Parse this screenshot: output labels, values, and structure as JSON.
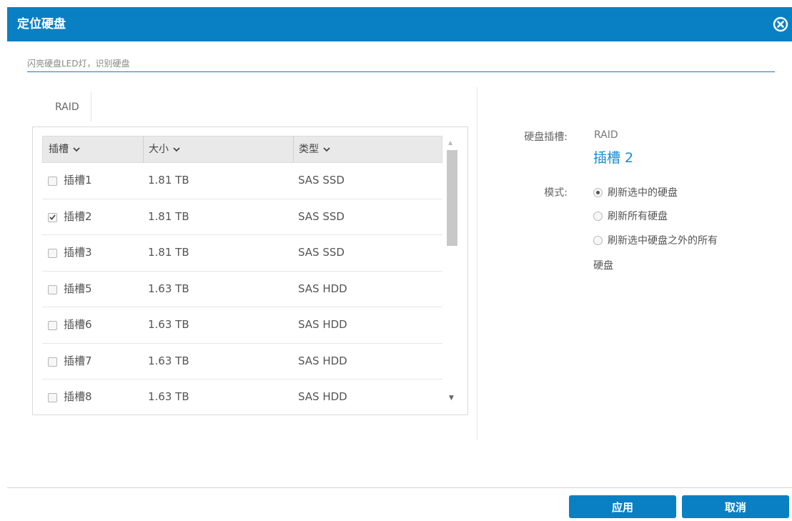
{
  "dialog": {
    "title": "定位硬盘",
    "subtitle": "闪亮硬盘LED灯，识别硬盘",
    "close_icon": "close-circle-icon",
    "accent_color": "#0a80c4"
  },
  "tab": {
    "label": "RAID"
  },
  "table": {
    "headers": [
      "插槽",
      "大小",
      "类型"
    ],
    "rows": [
      {
        "slot": "插槽1",
        "size": "1.81 TB",
        "type": "SAS SSD",
        "checked": false
      },
      {
        "slot": "插槽2",
        "size": "1.81 TB",
        "type": "SAS SSD",
        "checked": true
      },
      {
        "slot": "插槽3",
        "size": "1.81 TB",
        "type": "SAS SSD",
        "checked": false
      },
      {
        "slot": "插槽5",
        "size": "1.63 TB",
        "type": "SAS HDD",
        "checked": false
      },
      {
        "slot": "插槽6",
        "size": "1.63 TB",
        "type": "SAS HDD",
        "checked": false
      },
      {
        "slot": "插槽7",
        "size": "1.63 TB",
        "type": "SAS HDD",
        "checked": false
      },
      {
        "slot": "插槽8",
        "size": "1.63 TB",
        "type": "SAS HDD",
        "checked": false
      }
    ]
  },
  "details": {
    "disk_slot_label": "硬盘插槽:",
    "disk_slot_group": "RAID",
    "disk_slot_value": "插槽 2",
    "mode_label": "模式:",
    "mode_options": [
      "刷新选中的硬盘",
      "刷新所有硬盘",
      "刷新选中硬盘之外的所有"
    ],
    "mode_option_3_wrap": "硬盘",
    "mode_selected_index": 0
  },
  "footer": {
    "apply_label": "应用",
    "cancel_label": "取消"
  }
}
